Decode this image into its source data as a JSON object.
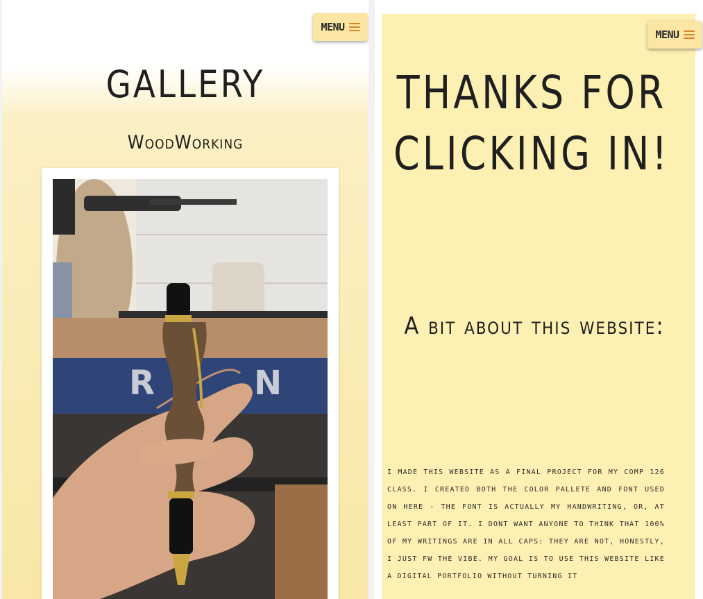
{
  "left_page": {
    "menu_label": "MENU",
    "title": "GALLERY",
    "subtitle": "WoodWorking",
    "photo_alt": "hand holding a turned wooden pen in front of a lathe"
  },
  "right_page": {
    "menu_label": "MENU",
    "title": "THANKS FOR CLICKING IN!",
    "about_heading": "A bit about this website:",
    "about_text": "I made this website as a final project for my comp 126 class. I created both the color pallete and font used on here - the font is actually my handwriting, or, at least part of it. I dont want anyone to think that 100% of my writings are in all caps: they are not, honestly, I just fw the vibe. My goal is to use this website like a digital portfolio without turning it"
  },
  "colors": {
    "background_cream": "#fdf0b3",
    "gradient_bottom": "#f8e7a6",
    "menu_button": "#fbe7a3",
    "burger_accent": "#d9822b",
    "text_dark": "#1f1f1f"
  }
}
